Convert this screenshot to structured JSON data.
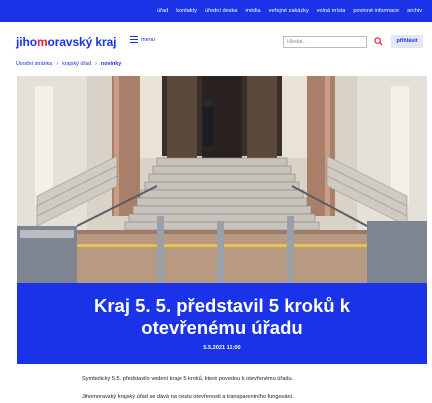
{
  "topnav": [
    "úřad",
    "kontakty",
    "úřední deska",
    "média",
    "veřejné zakázky",
    "volná místa",
    "povinné informace",
    "archiv"
  ],
  "logo": {
    "prefix": "jiho",
    "accent": "m",
    "suffix": "oravský kraj"
  },
  "menu_label": "menu",
  "search": {
    "placeholder": "Hledat…"
  },
  "login_label": "přihlásit",
  "breadcrumb": {
    "home": "Úvodní stránka",
    "section": "krajský úřad",
    "current": "novinky"
  },
  "article": {
    "title": "Kraj 5. 5. představil 5 kroků k otevřenému úřadu",
    "date": "5.5.2021 11:00",
    "paragraphs": [
      "Symbolicky 5.5. představilo vedení kraje 5 kroků, které povedou k otevřenému úřadu.",
      "Jihomoravský krajský úřad se dává na cestu otevřenosti a transparentního fungování."
    ]
  },
  "colors": {
    "brand": "#1a32e8",
    "accent": "#e8203a"
  }
}
